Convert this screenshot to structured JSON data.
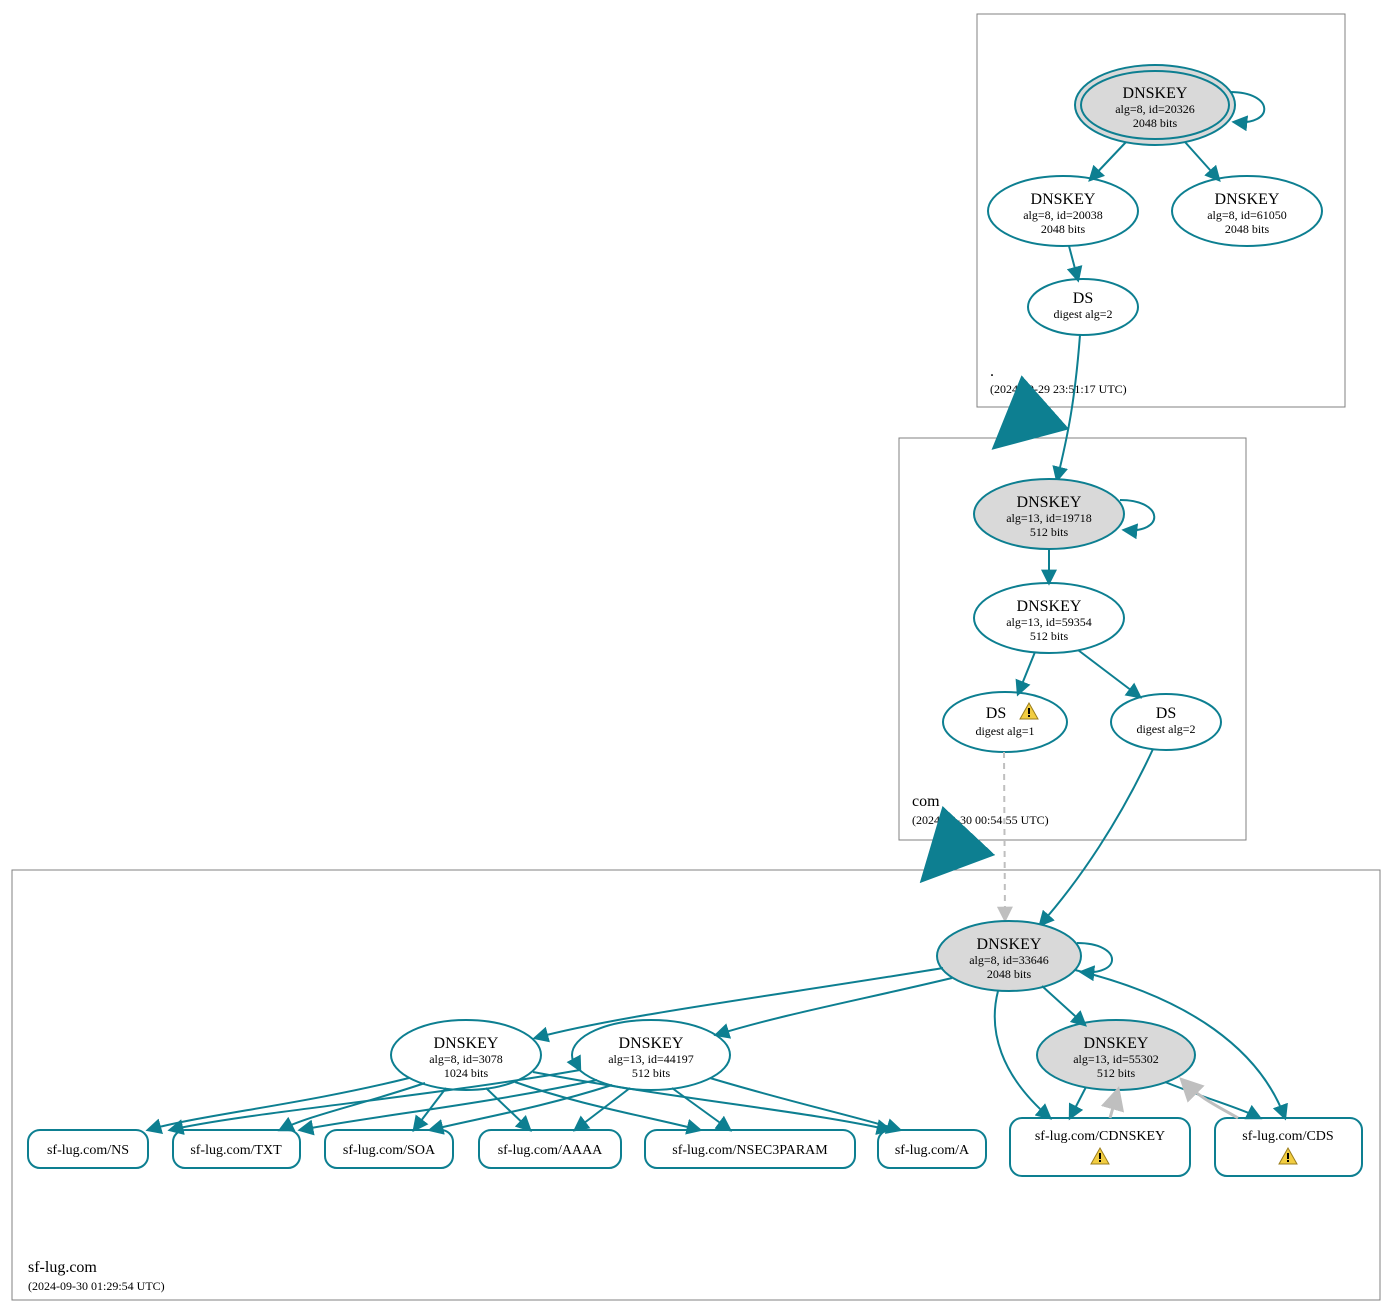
{
  "colors": {
    "stroke": "#0d7f91",
    "fill_grey": "#d9d9d9",
    "fill_white": "#ffffff",
    "edge_grey": "#bfbfbf",
    "zone_border": "#808080",
    "warn_fill": "#f2cd41",
    "warn_stroke": "#000000"
  },
  "zones": {
    "root": {
      "name": ".",
      "timestamp": "(2024-09-29 23:51:17 UTC)"
    },
    "com": {
      "name": "com",
      "timestamp": "(2024-09-30 00:54:55 UTC)"
    },
    "sflug": {
      "name": "sf-lug.com",
      "timestamp": "(2024-09-30 01:29:54 UTC)"
    }
  },
  "nodes": {
    "root_ksk": {
      "title": "DNSKEY",
      "line1": "alg=8, id=20326",
      "line2": "2048 bits"
    },
    "root_zsk1": {
      "title": "DNSKEY",
      "line1": "alg=8, id=20038",
      "line2": "2048 bits"
    },
    "root_zsk2": {
      "title": "DNSKEY",
      "line1": "alg=8, id=61050",
      "line2": "2048 bits"
    },
    "root_ds": {
      "title": "DS",
      "line1": "digest alg=2"
    },
    "com_ksk": {
      "title": "DNSKEY",
      "line1": "alg=13, id=19718",
      "line2": "512 bits"
    },
    "com_zsk": {
      "title": "DNSKEY",
      "line1": "alg=13, id=59354",
      "line2": "512 bits"
    },
    "com_ds1": {
      "title": "DS",
      "line1": "digest alg=1"
    },
    "com_ds2": {
      "title": "DS",
      "line1": "digest alg=2"
    },
    "sflug_ksk": {
      "title": "DNSKEY",
      "line1": "alg=8, id=33646",
      "line2": "2048 bits"
    },
    "sflug_k1": {
      "title": "DNSKEY",
      "line1": "alg=8, id=3078",
      "line2": "1024 bits"
    },
    "sflug_k2": {
      "title": "DNSKEY",
      "line1": "alg=13, id=44197",
      "line2": "512 bits"
    },
    "sflug_k3": {
      "title": "DNSKEY",
      "line1": "alg=13, id=55302",
      "line2": "512 bits"
    }
  },
  "rrsets": {
    "ns": "sf-lug.com/NS",
    "txt": "sf-lug.com/TXT",
    "soa": "sf-lug.com/SOA",
    "aaaa": "sf-lug.com/AAAA",
    "nsec3param": "sf-lug.com/NSEC3PARAM",
    "a": "sf-lug.com/A",
    "cdnskey": "sf-lug.com/CDNSKEY",
    "cds": "sf-lug.com/CDS"
  },
  "chart_data": {
    "type": "dnssec-chain",
    "zones": [
      {
        "name": ".",
        "timestamp": "2024-09-29 23:51:17 UTC",
        "keys": [
          {
            "id": 20326,
            "alg": 8,
            "bits": 2048,
            "role": "KSK",
            "self_signed": true
          },
          {
            "id": 20038,
            "alg": 8,
            "bits": 2048,
            "role": "ZSK"
          },
          {
            "id": 61050,
            "alg": 8,
            "bits": 2048,
            "role": "ZSK"
          }
        ],
        "ds": [
          {
            "digest_alg": 2,
            "signed_by": 20038,
            "points_to_zone": "com"
          }
        ]
      },
      {
        "name": "com",
        "timestamp": "2024-09-30 00:54:55 UTC",
        "keys": [
          {
            "id": 19718,
            "alg": 13,
            "bits": 512,
            "role": "KSK",
            "self_signed": true
          },
          {
            "id": 59354,
            "alg": 13,
            "bits": 512,
            "role": "ZSK"
          }
        ],
        "ds": [
          {
            "digest_alg": 1,
            "signed_by": 59354,
            "points_to_zone": "sf-lug.com",
            "warning": true
          },
          {
            "digest_alg": 2,
            "signed_by": 59354,
            "points_to_zone": "sf-lug.com"
          }
        ]
      },
      {
        "name": "sf-lug.com",
        "timestamp": "2024-09-30 01:29:54 UTC",
        "keys": [
          {
            "id": 33646,
            "alg": 8,
            "bits": 2048,
            "role": "KSK",
            "self_signed": true
          },
          {
            "id": 3078,
            "alg": 8,
            "bits": 1024,
            "role": "ZSK"
          },
          {
            "id": 44197,
            "alg": 13,
            "bits": 512,
            "role": "ZSK"
          },
          {
            "id": 55302,
            "alg": 13,
            "bits": 512,
            "role": "ZSK"
          }
        ],
        "rrsets": [
          {
            "name": "sf-lug.com/NS",
            "signed_by": [
              3078,
              44197
            ]
          },
          {
            "name": "sf-lug.com/TXT",
            "signed_by": [
              3078,
              44197
            ]
          },
          {
            "name": "sf-lug.com/SOA",
            "signed_by": [
              3078,
              44197
            ]
          },
          {
            "name": "sf-lug.com/AAAA",
            "signed_by": [
              3078,
              44197
            ]
          },
          {
            "name": "sf-lug.com/NSEC3PARAM",
            "signed_by": [
              3078,
              44197
            ]
          },
          {
            "name": "sf-lug.com/A",
            "signed_by": [
              3078,
              44197
            ]
          },
          {
            "name": "sf-lug.com/CDNSKEY",
            "signed_by": [
              33646,
              55302
            ],
            "warning": true,
            "extra_grey_edge_from": 55302
          },
          {
            "name": "sf-lug.com/CDS",
            "signed_by": [
              33646,
              55302
            ],
            "warning": true,
            "extra_grey_edge_from": 55302
          }
        ]
      }
    ]
  }
}
